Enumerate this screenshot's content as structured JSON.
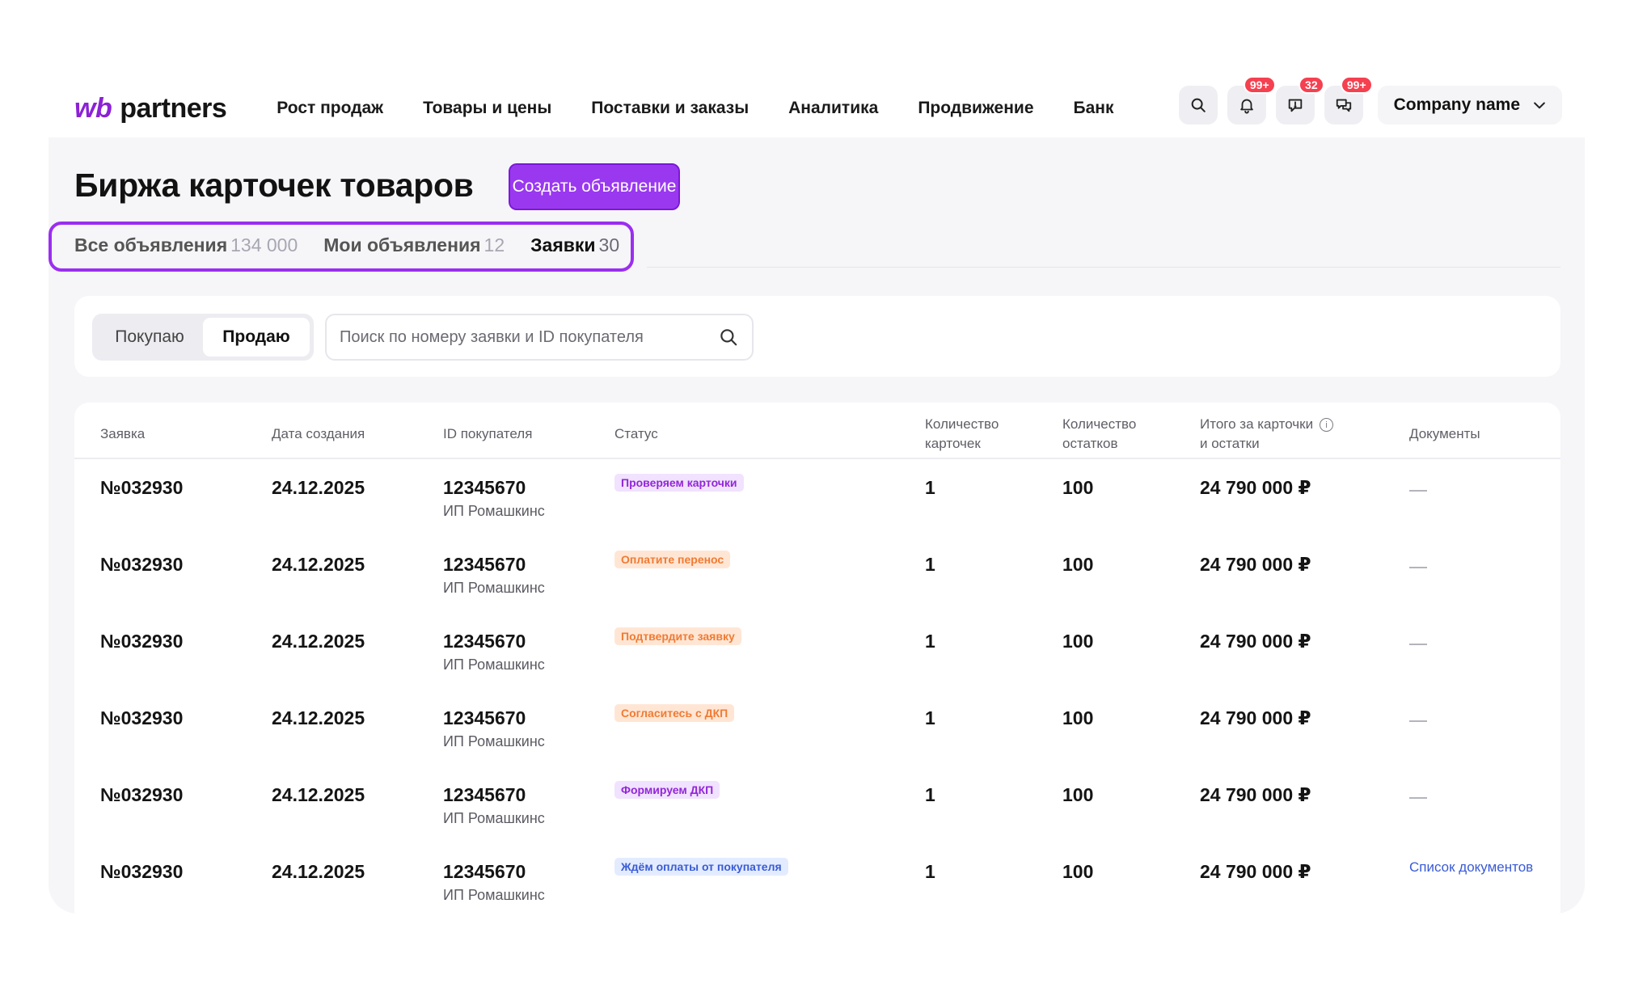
{
  "logo": {
    "brand": "wb",
    "product": "partners"
  },
  "nav": [
    {
      "label": "Рост продаж"
    },
    {
      "label": "Товары и цены"
    },
    {
      "label": "Поставки и заказы"
    },
    {
      "label": "Аналитика"
    },
    {
      "label": "Продвижение"
    },
    {
      "label": "Банк"
    }
  ],
  "toolbar": {
    "search_icon": "search-icon",
    "notifications": {
      "icon": "bell-icon",
      "badge": "99+"
    },
    "feedback": {
      "icon": "feedback-icon",
      "badge": "32"
    },
    "chat": {
      "icon": "chat-icon",
      "badge": "99+"
    },
    "company": {
      "label": "Company name",
      "icon": "chevron-down-icon"
    }
  },
  "page": {
    "title": "Биржа карточек товаров",
    "create_button": "Создать объявление"
  },
  "tabs": [
    {
      "label": "Все объявления",
      "count": "134 000",
      "active": false
    },
    {
      "label": "Мои объявления",
      "count": "12",
      "active": false
    },
    {
      "label": "Заявки",
      "count": "30",
      "active": true
    }
  ],
  "filters": {
    "segment": [
      {
        "label": "Покупаю",
        "active": false
      },
      {
        "label": "Продаю",
        "active": true
      }
    ],
    "search_placeholder": "Поиск по номеру заявки и ID покупателя",
    "search_value": ""
  },
  "table": {
    "headers": {
      "request": "Заявка",
      "created": "Дата создания",
      "buyer": "ID покупателя",
      "status": "Статус",
      "cards_1": "Количество",
      "cards_2": "карточек",
      "stock_1": "Количество",
      "stock_2": "остатков",
      "total_1": "Итого за карточки",
      "total_2": "и остатки",
      "docs": "Документы"
    },
    "rows": [
      {
        "request": "№032930",
        "created": "24.12.2025",
        "buyer_id": "12345670",
        "buyer_name": "ИП Ромашкинс",
        "status": "Проверяем карточки",
        "status_tone": "purple",
        "cards": "1",
        "stock": "100",
        "total": "24 790 000 ₽",
        "docs": "—"
      },
      {
        "request": "№032930",
        "created": "24.12.2025",
        "buyer_id": "12345670",
        "buyer_name": "ИП Ромашкинс",
        "status": "Оплатите перенос",
        "status_tone": "orange",
        "cards": "1",
        "stock": "100",
        "total": "24 790 000 ₽",
        "docs": "—"
      },
      {
        "request": "№032930",
        "created": "24.12.2025",
        "buyer_id": "12345670",
        "buyer_name": "ИП Ромашкинс",
        "status": "Подтвердите заявку",
        "status_tone": "orange",
        "cards": "1",
        "stock": "100",
        "total": "24 790 000 ₽",
        "docs": "—"
      },
      {
        "request": "№032930",
        "created": "24.12.2025",
        "buyer_id": "12345670",
        "buyer_name": "ИП Ромашкинс",
        "status": "Согласитесь с ДКП",
        "status_tone": "orange",
        "cards": "1",
        "stock": "100",
        "total": "24 790 000 ₽",
        "docs": "—"
      },
      {
        "request": "№032930",
        "created": "24.12.2025",
        "buyer_id": "12345670",
        "buyer_name": "ИП Ромашкинс",
        "status": "Формируем ДКП",
        "status_tone": "purple",
        "cards": "1",
        "stock": "100",
        "total": "24 790 000 ₽",
        "docs": "—"
      },
      {
        "request": "№032930",
        "created": "24.12.2025",
        "buyer_id": "12345670",
        "buyer_name": "ИП Ромашкинс",
        "status": "Ждём оплаты от покупателя",
        "status_tone": "blue",
        "cards": "1",
        "stock": "100",
        "total": "24 790 000 ₽",
        "docs": "Список документов"
      }
    ]
  },
  "colors": {
    "accent": "#9a38f0",
    "badge": "#f5404f",
    "status_purple": "#9227d6",
    "status_orange": "#ef7b34",
    "status_blue": "#3a5bd6"
  }
}
